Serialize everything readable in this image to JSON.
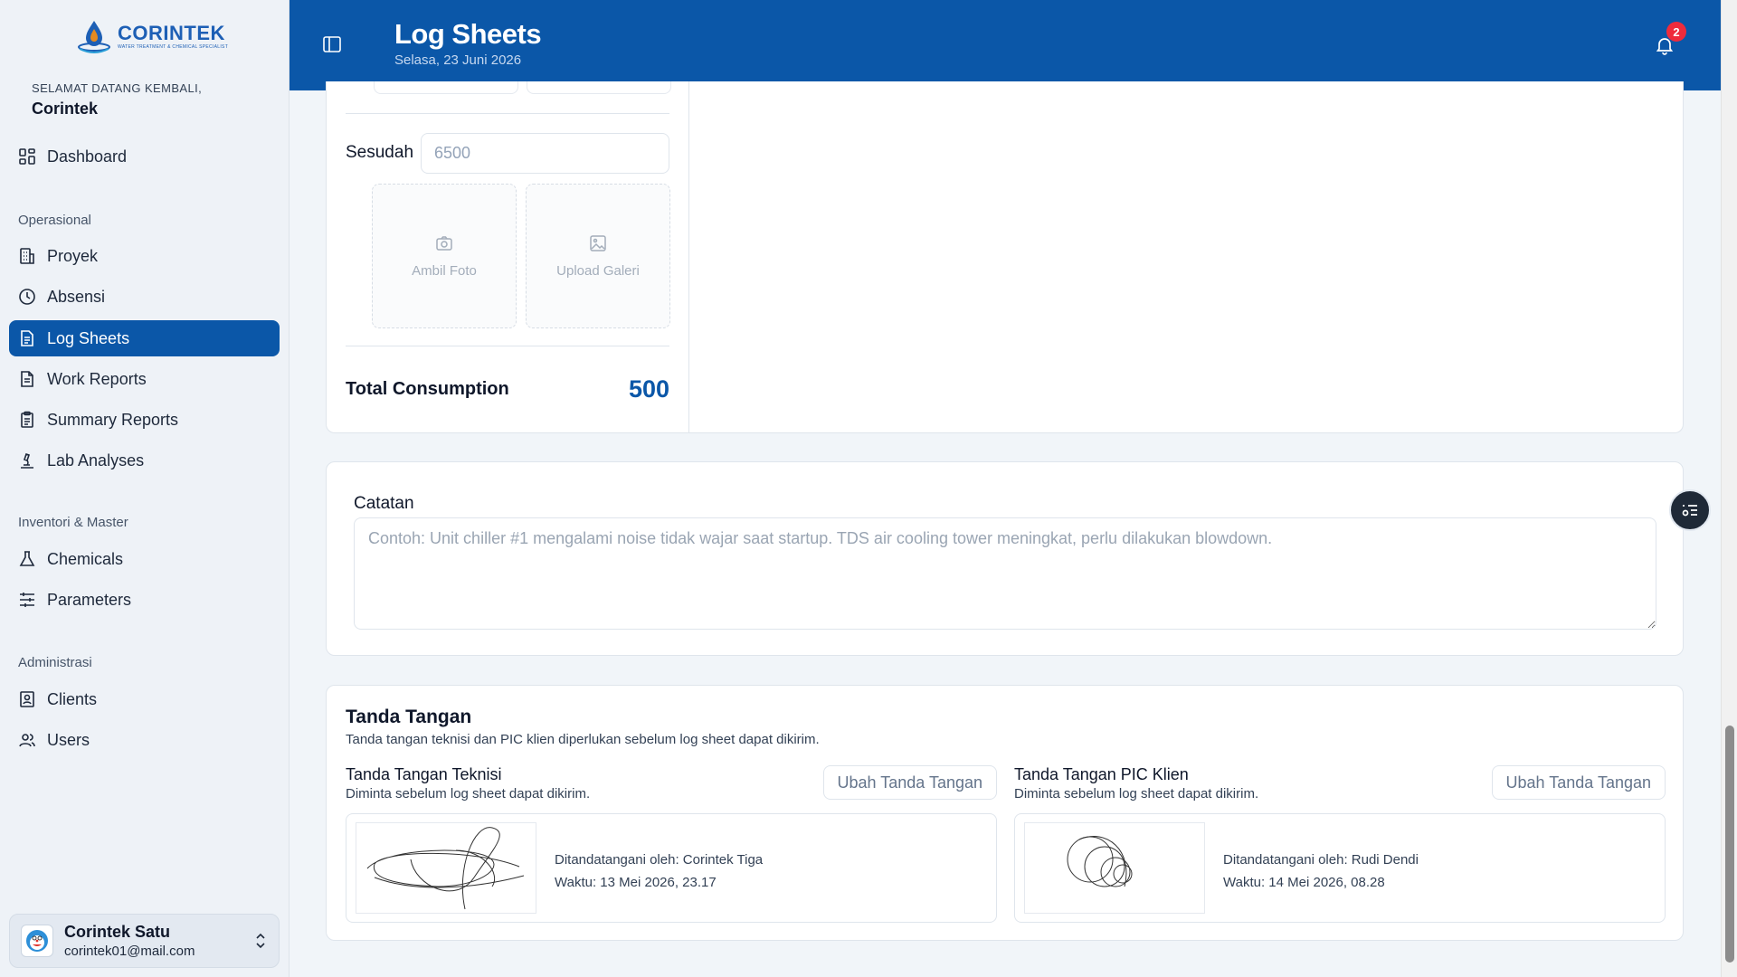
{
  "sidebar": {
    "brand": {
      "name": "CORINTEK",
      "tagline": "WATER TREATMENT & CHEMICAL SPECIALIST"
    },
    "welcome": "SELAMAT DATANG KEMBALI,",
    "user_name": "Corintek",
    "dashboard": "Dashboard",
    "sections": {
      "operasional": "Operasional",
      "inventori": "Inventori & Master",
      "administrasi": "Administrasi"
    },
    "items": {
      "proyek": "Proyek",
      "absensi": "Absensi",
      "log_sheets": "Log Sheets",
      "work_reports": "Work Reports",
      "summary_reports": "Summary Reports",
      "lab_analyses": "Lab Analyses",
      "chemicals": "Chemicals",
      "parameters": "Parameters",
      "clients": "Clients",
      "users": "Users"
    },
    "active_item": "log_sheets",
    "account": {
      "name": "Corintek Satu",
      "email": "corintek01@mail.com"
    }
  },
  "header": {
    "title": "Log Sheets",
    "date": "Selasa, 23 Juni 2026",
    "notification_count": "2"
  },
  "meter": {
    "after_label": "Sesudah",
    "after_placeholder": "6500",
    "take_photo": "Ambil Foto",
    "upload_gallery": "Upload Galeri",
    "total_label": "Total Consumption",
    "total_value": "500"
  },
  "notes": {
    "label": "Catatan",
    "placeholder": "Contoh: Unit chiller #1 mengalami noise tidak wajar saat startup. TDS air cooling tower meningkat, perlu dilakukan blowdown."
  },
  "signatures": {
    "title": "Tanda Tangan",
    "description": "Tanda tangan teknisi dan PIC klien diperlukan sebelum log sheet dapat dikirim.",
    "technician": {
      "title": "Tanda Tangan Teknisi",
      "desc": "Diminta sebelum log sheet dapat dikirim.",
      "change": "Ubah Tanda Tangan",
      "signed_by": "Ditandatangani oleh: Corintek Tiga",
      "time": "Waktu: 13 Mei 2026, 23.17"
    },
    "client": {
      "title": "Tanda Tangan PIC Klien",
      "desc": "Diminta sebelum log sheet dapat dikirim.",
      "change": "Ubah Tanda Tangan",
      "signed_by": "Ditandatangani oleh: Rudi Dendi",
      "time": "Waktu: 14 Mei 2026, 08.28"
    }
  },
  "colors": {
    "primary": "#0b57a8",
    "badge": "#ef2b3c",
    "sidebar_bg": "#eef2f7"
  }
}
